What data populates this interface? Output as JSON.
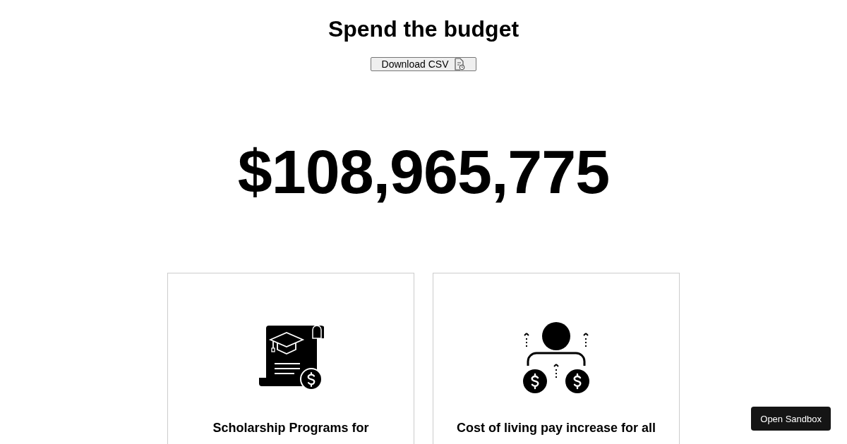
{
  "title": "Spend the budget",
  "download_button": {
    "label": "Download CSV"
  },
  "budget_total": "$108,965,775",
  "cards": [
    {
      "kind": "scholarship",
      "title": "Scholarship Programs for"
    },
    {
      "kind": "pay-raise",
      "title": "Cost of living pay increase for all"
    }
  ],
  "sandbox_button": {
    "label": "Open Sandbox"
  }
}
